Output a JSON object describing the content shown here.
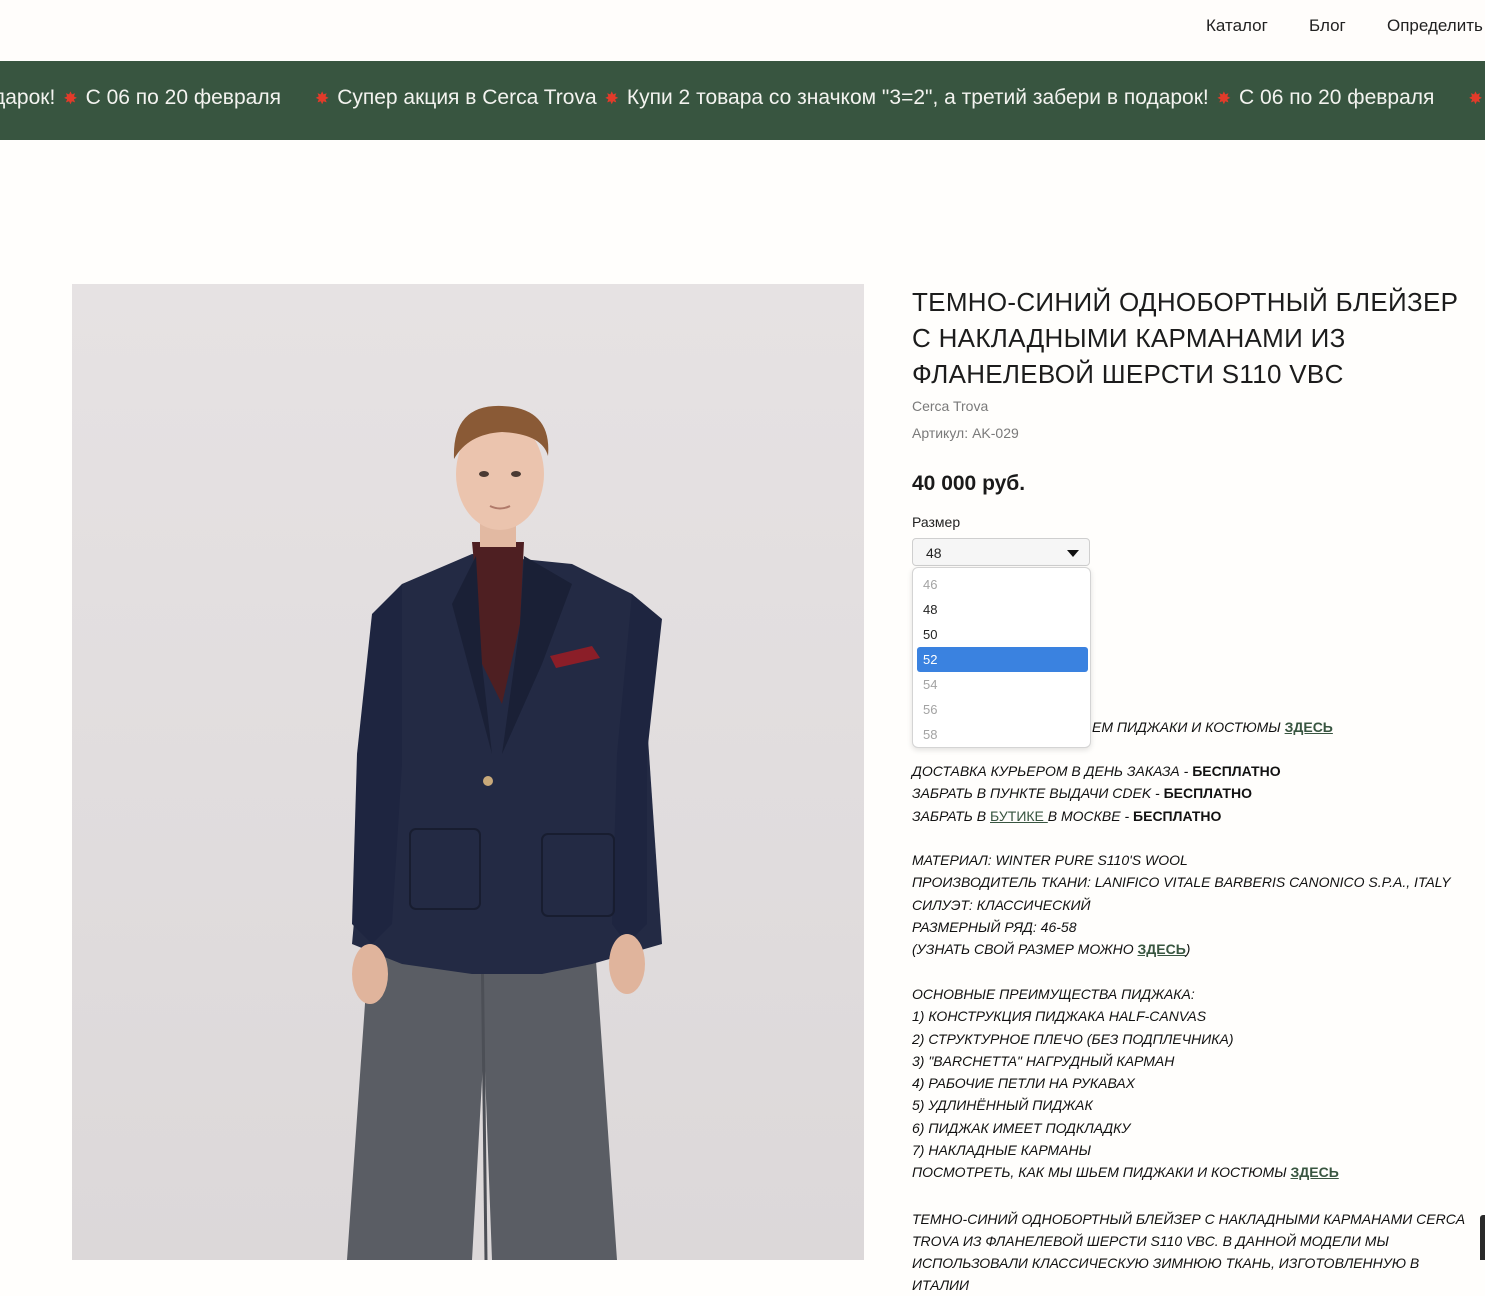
{
  "nav": {
    "items": [
      "Каталог",
      "Блог",
      "Определить"
    ]
  },
  "promo": {
    "text_a": "дарок!",
    "text_b": "С 06 по 20 февраля",
    "text_c": "Супер акция в Cerca Trova",
    "text_d": "Купи 2 товара со значком \"3=2\", а третий забери в подарок!",
    "text_e": "С 06 по 20 февраля",
    "background": "#385540"
  },
  "product": {
    "title": "ТЕМНО-СИНИЙ ОДНОБОРТНЫЙ БЛЕЙЗЕР С НАКЛАДНЫМИ КАРМАНАМИ ИЗ ФЛАНЕЛЕВОЙ ШЕРСТИ S110 VBC",
    "brand": "Cerca Trova",
    "sku_label": "Артикул:",
    "sku": "AK-029",
    "price": "40 000 руб.",
    "size_label": "Размер",
    "size_selected": "48",
    "size_options": [
      {
        "label": "46",
        "state": "disabled"
      },
      {
        "label": "48",
        "state": "enabled"
      },
      {
        "label": "50",
        "state": "enabled"
      },
      {
        "label": "52",
        "state": "highlighted"
      },
      {
        "label": "54",
        "state": "disabled"
      },
      {
        "label": "56",
        "state": "disabled"
      },
      {
        "label": "58",
        "state": "disabled"
      }
    ]
  },
  "description": {
    "partial_line": "ЕМ ПИДЖАКИ И КОСТЮМЫ ",
    "here": "ЗДЕСЬ",
    "delivery_1": "ДОСТАВКА КУРЬЕРОМ В ДЕНЬ ЗАКАЗА - ",
    "delivery_2": "ЗАБРАТЬ В ПУНКТЕ ВЫДАЧИ CDEK - ",
    "delivery_3a": "ЗАБРАТЬ В ",
    "delivery_3_link": "БУТИКЕ ",
    "delivery_3b": "В МОСКВЕ - ",
    "free": "БЕСПЛАТНО",
    "material": "МАТЕРИАЛ: WINTER PURE S110'S WOOL",
    "fabric_maker": "ПРОИЗВОДИТЕЛЬ ТКАНИ: LANIFICO VITALE BARBERIS CANONICO S.P.A., ITALY",
    "silhouette": "СИЛУЭТ: КЛАССИЧЕСКИЙ",
    "size_range": "РАЗМЕРНЫЙ РЯД: 46-58",
    "size_hint_a": "(УЗНАТЬ СВОЙ РАЗМЕР МОЖНО ",
    "size_hint_b": ")",
    "benefits_title": "ОСНОВНЫЕ ПРЕИМУЩЕСТВА ПИДЖАКА:",
    "benefits": [
      "1) КОНСТРУКЦИЯ ПИДЖАКА HALF-CANVAS",
      "2) СТРУКТУРНОЕ ПЛЕЧО (БЕЗ ПОДПЛЕЧНИКА)",
      "3) \"BARCHETTA\" НАГРУДНЫЙ КАРМАН",
      "4) РАБОЧИЕ ПЕТЛИ НА РУКАВАХ",
      "5) УДЛИНЁННЫЙ ПИДЖАК",
      "6) ПИДЖАК ИМЕЕТ ПОДКЛАДКУ",
      "7) НАКЛАДНЫЕ КАРМАНЫ"
    ],
    "how_we_sew": "ПОСМОТРЕТЬ, КАК МЫ ШЬЕМ ПИДЖАКИ И КОСТЮМЫ ",
    "closing_text": "ТЕМНО-СИНИЙ ОДНОБОРТНЫЙ БЛЕЙЗЕР С НАКЛАДНЫМИ КАРМАНАМИ CERCA TROVA ИЗ ФЛАНЕЛЕВОЙ ШЕРСТИ S110 VBC. В ДАННОЙ МОДЕЛИ МЫ ИСПОЛЬЗОВАЛИ КЛАССИЧЕСКУЮ ЗИМНЮЮ ТКАНЬ, ИЗГОТОВЛЕННУЮ В ИТАЛИИ"
  },
  "colors": {
    "accent_green": "#385540",
    "select_highlight": "#3a82e0"
  }
}
